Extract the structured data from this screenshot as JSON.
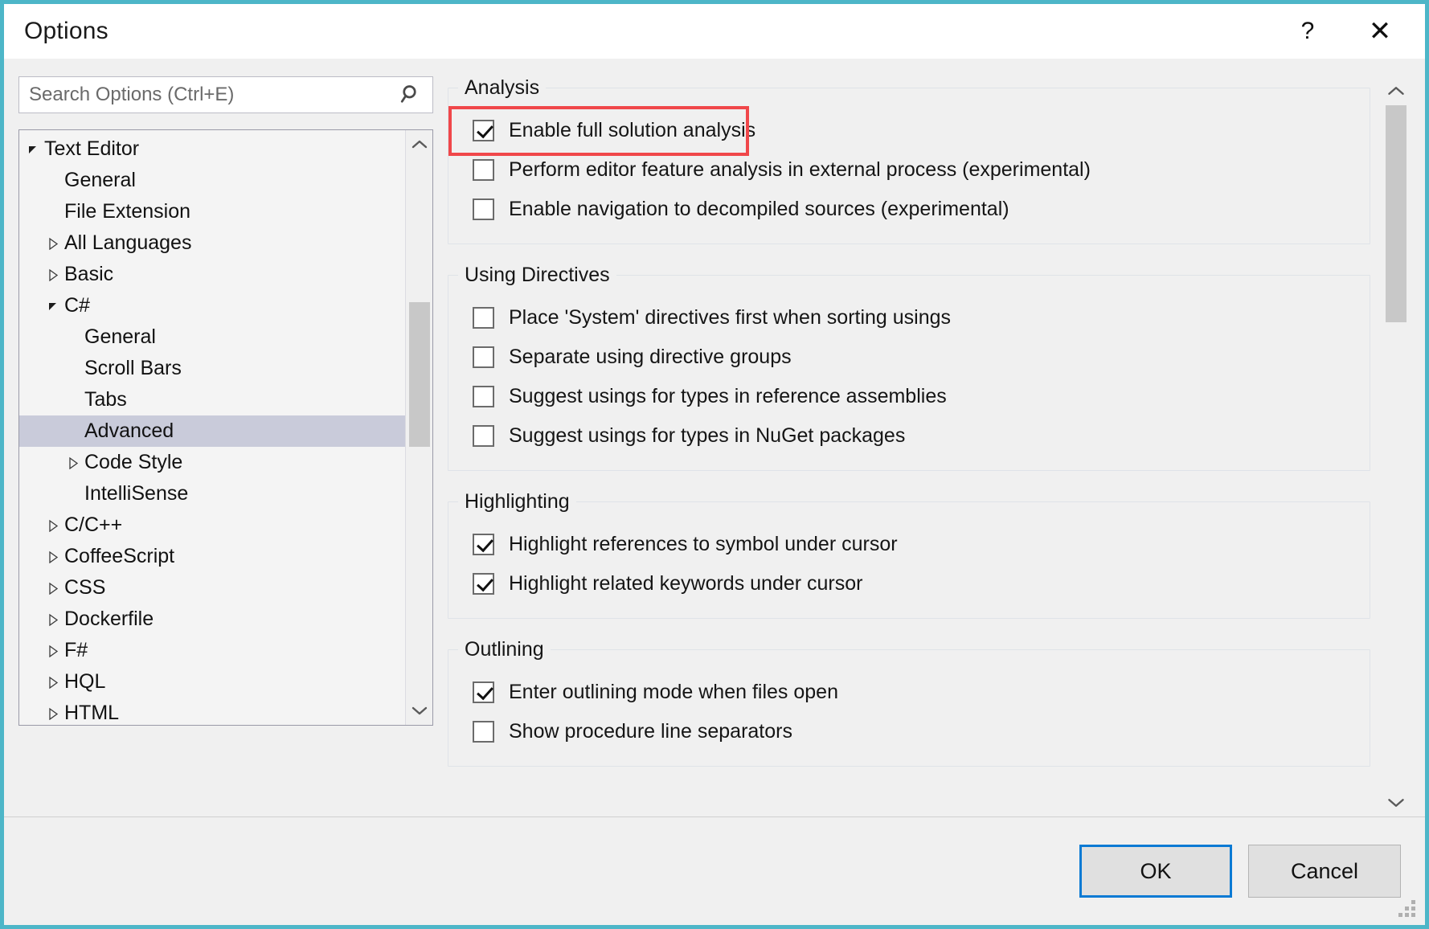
{
  "window": {
    "title": "Options",
    "border_color": "#4db6c8",
    "help_icon": "help-question-icon",
    "close_icon": "close-x-icon"
  },
  "search": {
    "placeholder": "Search Options (Ctrl+E)",
    "value": "",
    "icon": "search-magnifier-icon"
  },
  "tree": {
    "items": [
      {
        "label": "Text Editor",
        "level": 0,
        "expander": "expanded",
        "selected": false
      },
      {
        "label": "General",
        "level": 1,
        "expander": "none",
        "selected": false
      },
      {
        "label": "File Extension",
        "level": 1,
        "expander": "none",
        "selected": false
      },
      {
        "label": "All Languages",
        "level": 1,
        "expander": "collapsed",
        "selected": false
      },
      {
        "label": "Basic",
        "level": 1,
        "expander": "collapsed",
        "selected": false
      },
      {
        "label": "C#",
        "level": 1,
        "expander": "expanded",
        "selected": false
      },
      {
        "label": "General",
        "level": 2,
        "expander": "none",
        "selected": false
      },
      {
        "label": "Scroll Bars",
        "level": 2,
        "expander": "none",
        "selected": false
      },
      {
        "label": "Tabs",
        "level": 2,
        "expander": "none",
        "selected": false
      },
      {
        "label": "Advanced",
        "level": 2,
        "expander": "none",
        "selected": true
      },
      {
        "label": "Code Style",
        "level": 2,
        "expander": "collapsed",
        "selected": false
      },
      {
        "label": "IntelliSense",
        "level": 2,
        "expander": "none",
        "selected": false
      },
      {
        "label": "C/C++",
        "level": 1,
        "expander": "collapsed",
        "selected": false
      },
      {
        "label": "CoffeeScript",
        "level": 1,
        "expander": "collapsed",
        "selected": false
      },
      {
        "label": "CSS",
        "level": 1,
        "expander": "collapsed",
        "selected": false
      },
      {
        "label": "Dockerfile",
        "level": 1,
        "expander": "collapsed",
        "selected": false
      },
      {
        "label": "F#",
        "level": 1,
        "expander": "collapsed",
        "selected": false
      },
      {
        "label": "HQL",
        "level": 1,
        "expander": "collapsed",
        "selected": false
      },
      {
        "label": "HTML",
        "level": 1,
        "expander": "collapsed",
        "selected": false
      }
    ],
    "scrollbar": {
      "up_icon": "chevron-up-icon",
      "down_icon": "chevron-down-icon"
    }
  },
  "options": {
    "groups": [
      {
        "legend": "Analysis",
        "rows": [
          {
            "label": "Enable full solution analysis",
            "checked": true,
            "highlighted": true
          },
          {
            "label": "Perform editor feature analysis in external process (experimental)",
            "checked": false,
            "highlighted": false
          },
          {
            "label": "Enable navigation to decompiled sources (experimental)",
            "checked": false,
            "highlighted": false
          }
        ]
      },
      {
        "legend": "Using Directives",
        "rows": [
          {
            "label": "Place 'System' directives first when sorting usings",
            "checked": false,
            "highlighted": false
          },
          {
            "label": "Separate using directive groups",
            "checked": false,
            "highlighted": false
          },
          {
            "label": "Suggest usings for types in reference assemblies",
            "checked": false,
            "highlighted": false
          },
          {
            "label": "Suggest usings for types in NuGet packages",
            "checked": false,
            "highlighted": false
          }
        ]
      },
      {
        "legend": "Highlighting",
        "rows": [
          {
            "label": "Highlight references to symbol under cursor",
            "checked": true,
            "highlighted": false
          },
          {
            "label": "Highlight related keywords under cursor",
            "checked": true,
            "highlighted": false
          }
        ]
      },
      {
        "legend": "Outlining",
        "rows": [
          {
            "label": "Enter outlining mode when files open",
            "checked": true,
            "highlighted": false
          },
          {
            "label": "Show procedure line separators",
            "checked": false,
            "highlighted": false
          }
        ]
      }
    ],
    "scrollbar": {
      "up_icon": "chevron-up-icon",
      "down_icon": "chevron-down-icon"
    },
    "highlight_color": "#f0474a"
  },
  "footer": {
    "ok_label": "OK",
    "cancel_label": "Cancel",
    "grip_icon": "resize-grip-icon"
  }
}
